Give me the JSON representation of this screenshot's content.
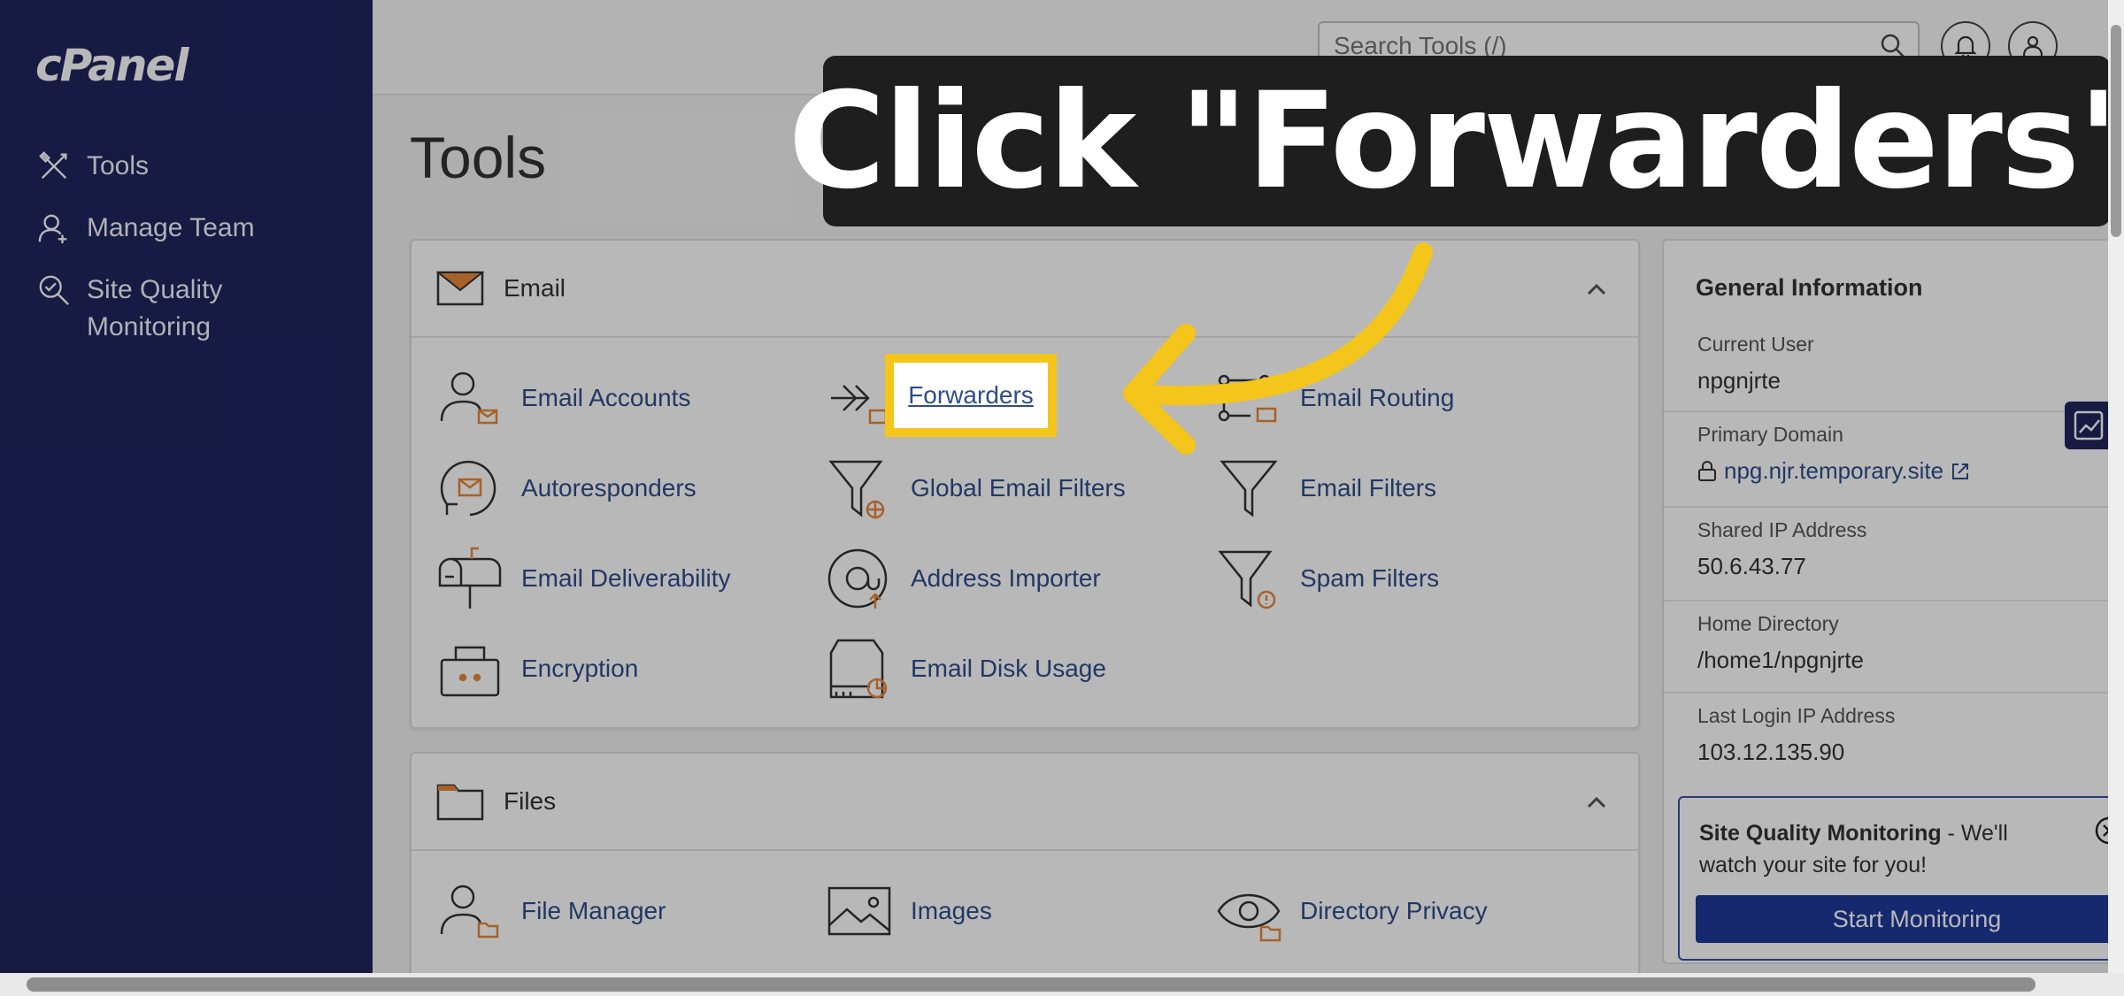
{
  "sidebar": {
    "logo": "cPanel",
    "items": [
      {
        "label": "Tools",
        "icon": "tools-icon"
      },
      {
        "label": "Manage Team",
        "icon": "team-icon"
      },
      {
        "label": "Site Quality",
        "label2": "Monitoring",
        "icon": "site-quality-icon"
      }
    ]
  },
  "topbar": {
    "search_placeholder": "Search Tools (/)"
  },
  "page_title": "Tools",
  "email_section": {
    "title": "Email",
    "tools": [
      {
        "label": "Email Accounts"
      },
      {
        "label": "Forwarders"
      },
      {
        "label": "Email Routing"
      },
      {
        "label": "Autoresponders"
      },
      {
        "label": "Global Email Filters"
      },
      {
        "label": "Email Filters"
      },
      {
        "label": "Email Deliverability"
      },
      {
        "label": "Address Importer"
      },
      {
        "label": "Spam Filters"
      },
      {
        "label": "Encryption"
      },
      {
        "label": "Email Disk Usage"
      }
    ]
  },
  "files_section": {
    "title": "Files",
    "tools": [
      {
        "label": "File Manager"
      },
      {
        "label": "Images"
      },
      {
        "label": "Directory Privacy"
      }
    ]
  },
  "general_info": {
    "title": "General Information",
    "current_user_label": "Current User",
    "current_user": "npgnjrte",
    "primary_domain_label": "Primary Domain",
    "primary_domain": "npg.njr.temporary.site",
    "shared_ip_label": "Shared IP Address",
    "shared_ip": "50.6.43.77",
    "home_dir_label": "Home Directory",
    "home_dir": "/home1/npgnjrte",
    "last_login_label": "Last Login IP Address",
    "last_login": "103.12.135.90"
  },
  "sqm_promo": {
    "title": "Site Quality Monitoring",
    "text": " - We'll watch your site for you!",
    "button": "Start Monitoring"
  },
  "annotation": {
    "banner": "Click \"Forwarders\"",
    "highlight_color": "#f4c51a"
  },
  "colors": {
    "sidebar": "#20245e",
    "link": "#2e4e8c",
    "accent_orange": "#e8873a",
    "primary_button": "#1f3a9a"
  }
}
